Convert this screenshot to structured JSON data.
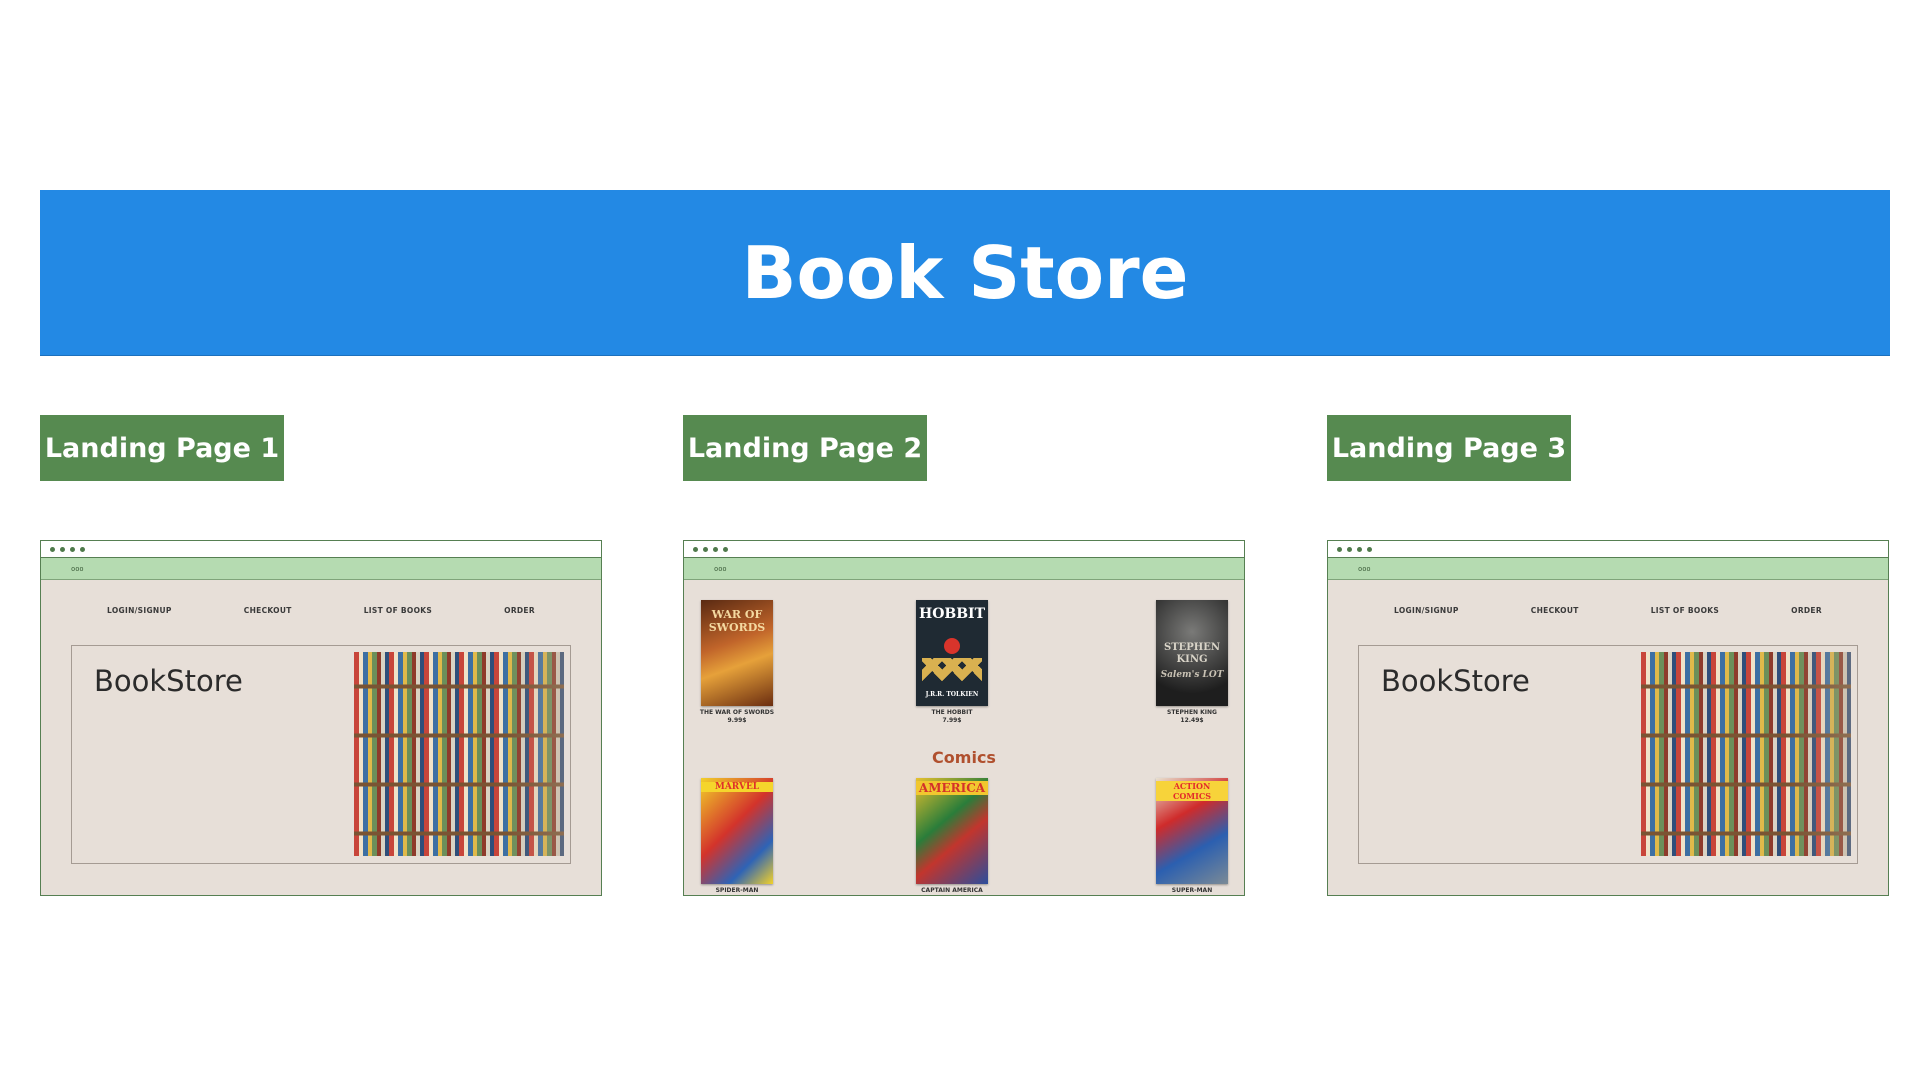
{
  "title": "Book Store",
  "labels": [
    "Landing Page 1",
    "Landing Page 2",
    "Landing Page 3"
  ],
  "browser": {
    "address": "ooo"
  },
  "nav": [
    "LOGIN/SIGNUP",
    "CHECKOUT",
    "LIST OF BOOKS",
    "ORDER"
  ],
  "hero": {
    "brand": "BookStore"
  },
  "books": [
    {
      "title": "THE WAR OF SWORDS",
      "price": "9.99$",
      "cover_text": "WAR OF SWORDS"
    },
    {
      "title": "THE HOBBIT",
      "price": "7.99$",
      "cover_text": "HOBBIT",
      "cover_author": "J.R.R. TOLKIEN"
    },
    {
      "title": "STEPHEN KING",
      "price": "12.49$",
      "cover_text": "STEPHEN KING",
      "cover_sub": "Salem's LOT"
    }
  ],
  "comics_heading": "Comics",
  "comics": [
    {
      "title": "SPIDER-MAN",
      "cover_text": "MARVEL"
    },
    {
      "title": "CAPTAIN AMERICA",
      "cover_text": "AMERICA"
    },
    {
      "title": "SUPER-MAN",
      "cover_text": "ACTION COMICS"
    }
  ],
  "colors": {
    "banner": "#2389e4",
    "label": "#568a50",
    "frame_bg": "#e7dfd8",
    "address_bar": "#b5dbb1",
    "comics_heading": "#b0502e"
  }
}
